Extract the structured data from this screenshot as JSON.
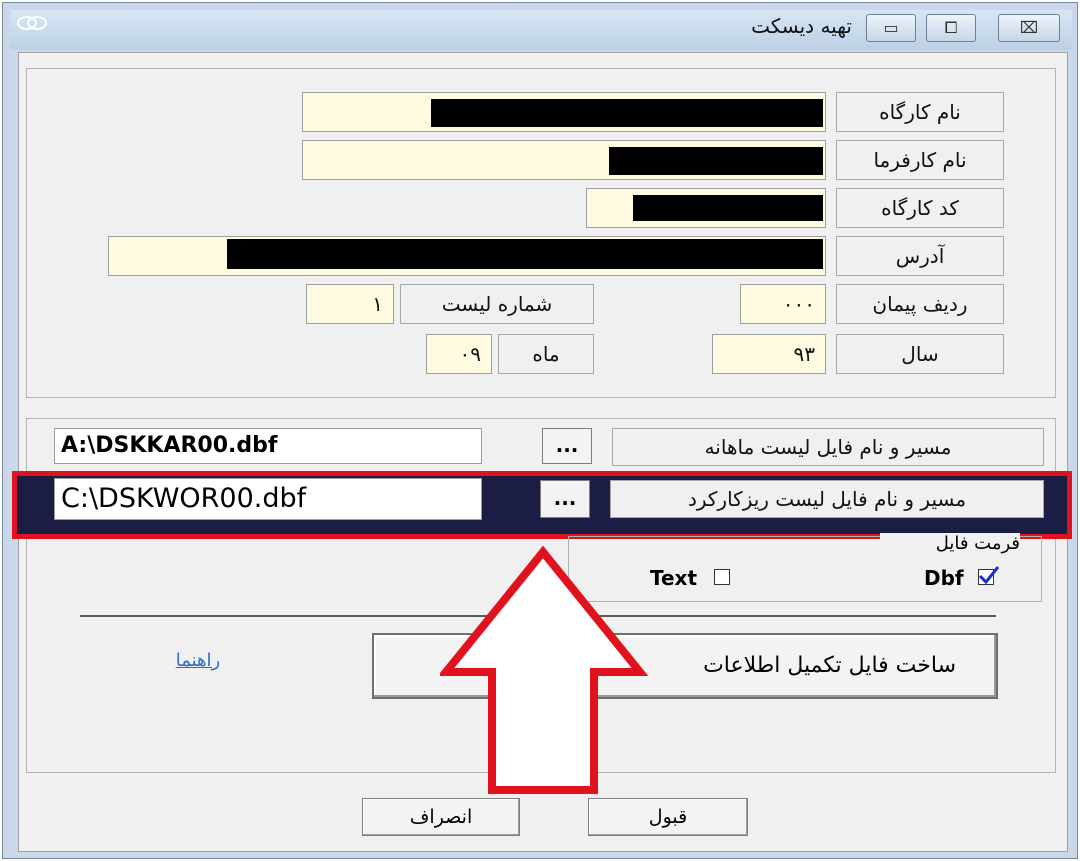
{
  "window": {
    "title": "تهیه دیسکت",
    "app_icon": "app-logo-icon",
    "caption_buttons": {
      "minimize": "▭",
      "maximize": "⧠",
      "close": "⌧"
    }
  },
  "info": {
    "workshop_name_label": "نام کارگاه",
    "employer_name_label": "نام کارفرما",
    "workshop_code_label": "کد کارگاه",
    "address_label": "آدرس",
    "contract_row_label": "ردیف پیمان",
    "contract_row_value": "۰۰۰",
    "list_number_label": "شماره لیست",
    "list_number_value": "۱",
    "year_label": "سال",
    "year_value": "۹۳",
    "month_label": "ماه",
    "month_value": "۰۹"
  },
  "files": {
    "monthly_list_label": "مسیر و نام فایل لیست ماهانه",
    "monthly_list_path": "A:\\DSKKAR00.dbf",
    "detail_list_label": "مسیر و نام فایل لیست ریزکارکرد",
    "detail_list_path": "C:\\DSKWOR00.dbf",
    "browse_label": "...",
    "format_title": "فرمت فایل",
    "format_text_label": "Text",
    "format_text_checked": false,
    "format_dbf_label": "Dbf",
    "format_dbf_checked": true
  },
  "actions": {
    "build_button_label": "ساخت فایل تکمیل اطلاعات",
    "help_link": "راهنما",
    "ok_label": "قبول",
    "cancel_label": "انصراف"
  },
  "annotation": {
    "highlight_color": "#e0121e"
  }
}
